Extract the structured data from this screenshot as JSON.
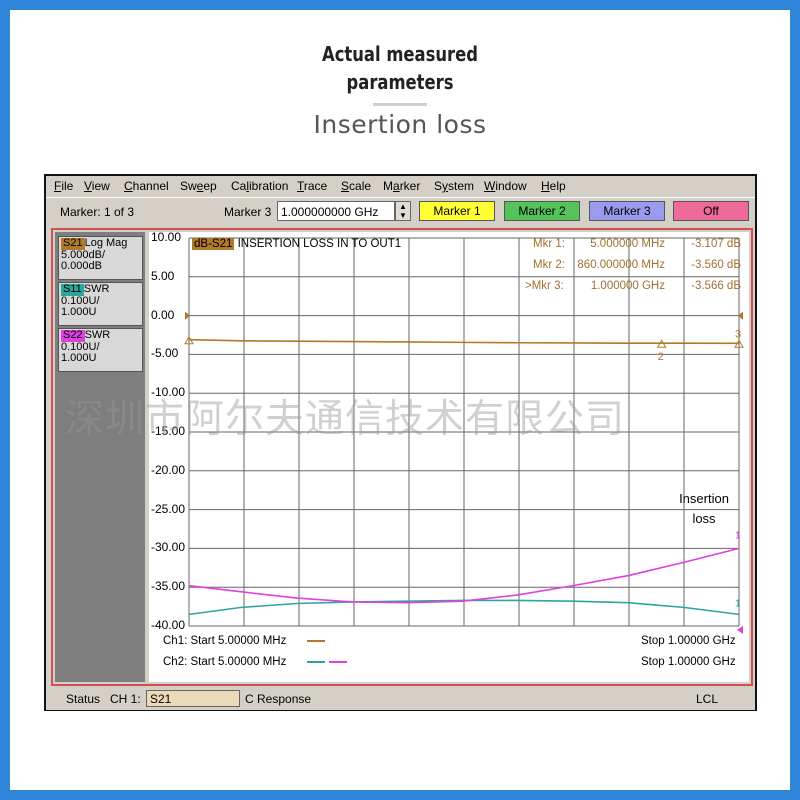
{
  "header": {
    "title_line1": "Actual measured",
    "title_line2": "parameters",
    "subtitle": "Insertion loss"
  },
  "menu": [
    {
      "u": "F",
      "rest": "ile"
    },
    {
      "u": "V",
      "rest": "iew"
    },
    {
      "u": "C",
      "rest": "hannel"
    },
    {
      "pre": "Sw",
      "u": "e",
      "rest": "ep"
    },
    {
      "pre": "Ca",
      "u": "l",
      "rest": "ibration"
    },
    {
      "u": "T",
      "rest": "race"
    },
    {
      "u": "S",
      "rest": "cale"
    },
    {
      "pre": "M",
      "u": "a",
      "rest": "rker"
    },
    {
      "pre": "S",
      "u": "y",
      "rest": "stem"
    },
    {
      "u": "W",
      "rest": "indow"
    },
    {
      "u": "H",
      "rest": "elp"
    }
  ],
  "toolbar": {
    "marker_count": "Marker: 1 of 3",
    "marker_select_label": "Marker 3",
    "marker_freq_value": "1.000000000 GHz",
    "btn_marker1": "Marker 1",
    "btn_marker2": "Marker 2",
    "btn_marker3": "Marker 3",
    "btn_off": "Off"
  },
  "traces": [
    {
      "tag": "S21",
      "tag_color": "#b07a2a",
      "format": "Log Mag",
      "line2": "5.000dB/",
      "line3": "0.000dB"
    },
    {
      "tag": "S11",
      "tag_color": "#2aa79a",
      "format": "SWR",
      "line2": "0.100U/",
      "line3": "1.000U"
    },
    {
      "tag": "S22",
      "tag_color": "#e040e0",
      "format": "SWR",
      "line2": "0.100U/",
      "line3": "1.000U"
    }
  ],
  "plot": {
    "trace_tag": "dB-S21",
    "trace_title": "INSERTION LOSS IN TO OUT1",
    "markers": [
      {
        "label": "Mkr  1:",
        "freq": "5.000000 MHz",
        "value": "-3.107 dB"
      },
      {
        "label": "Mkr  2:",
        "freq": "860.000000 MHz",
        "value": "-3.560 dB"
      },
      {
        "label": ">Mkr  3:",
        "freq": "1.000000 GHz",
        "value": "-3.566 dB"
      }
    ],
    "ch1_start": "Ch1: Start  5.00000 MHz",
    "ch2_start": "Ch2: Start  5.00000 MHz",
    "ch1_stop": "Stop  1.00000 GHz",
    "ch2_stop": "Stop  1.00000 GHz",
    "annotation_line1": "Insertion",
    "annotation_line2": "loss",
    "marker_label_2": "2",
    "marker_label_3": "3",
    "marker_label_1": "1"
  },
  "chart_data": {
    "type": "line",
    "y_ticks": [
      "10.00",
      "5.00",
      "0.00",
      "-5.00",
      "-10.00",
      "-15.00",
      "-20.00",
      "-25.00",
      "-30.00",
      "-35.00",
      "-40.00"
    ],
    "ylim": [
      -40,
      10
    ],
    "xlim_mhz": [
      5,
      1000
    ],
    "grid": true,
    "series": [
      {
        "name": "S21",
        "color": "#b07a2a",
        "x": [
          5,
          100,
          200,
          300,
          400,
          500,
          600,
          700,
          800,
          860,
          900,
          1000
        ],
        "y": [
          -3.107,
          -3.25,
          -3.3,
          -3.35,
          -3.4,
          -3.45,
          -3.5,
          -3.52,
          -3.55,
          -3.56,
          -3.56,
          -3.566
        ]
      },
      {
        "name": "S11",
        "color": "#2aa79a",
        "x": [
          5,
          100,
          200,
          300,
          400,
          500,
          600,
          700,
          800,
          900,
          1000
        ],
        "y": [
          -38.5,
          -37.6,
          -37.1,
          -36.9,
          -36.8,
          -36.7,
          -36.7,
          -36.8,
          -37.0,
          -37.6,
          -38.5
        ]
      },
      {
        "name": "S22",
        "color": "#e040e0",
        "x": [
          5,
          100,
          200,
          300,
          400,
          500,
          600,
          700,
          800,
          900,
          1000
        ],
        "y": [
          -34.8,
          -35.6,
          -36.4,
          -36.9,
          -37.0,
          -36.8,
          -36.0,
          -34.8,
          -33.5,
          -31.8,
          -30.0
        ]
      }
    ]
  },
  "watermark": "深圳市阿尔夫通信技术有限公司",
  "status": {
    "label": "Status",
    "channel": "CH 1:",
    "param": "S21",
    "response": "C  Response",
    "lcl": "LCL"
  },
  "colors": {
    "s21": "#b07a2a",
    "s11": "#2aa79a",
    "s22": "#e040e0",
    "frame_red": "#d05050"
  }
}
